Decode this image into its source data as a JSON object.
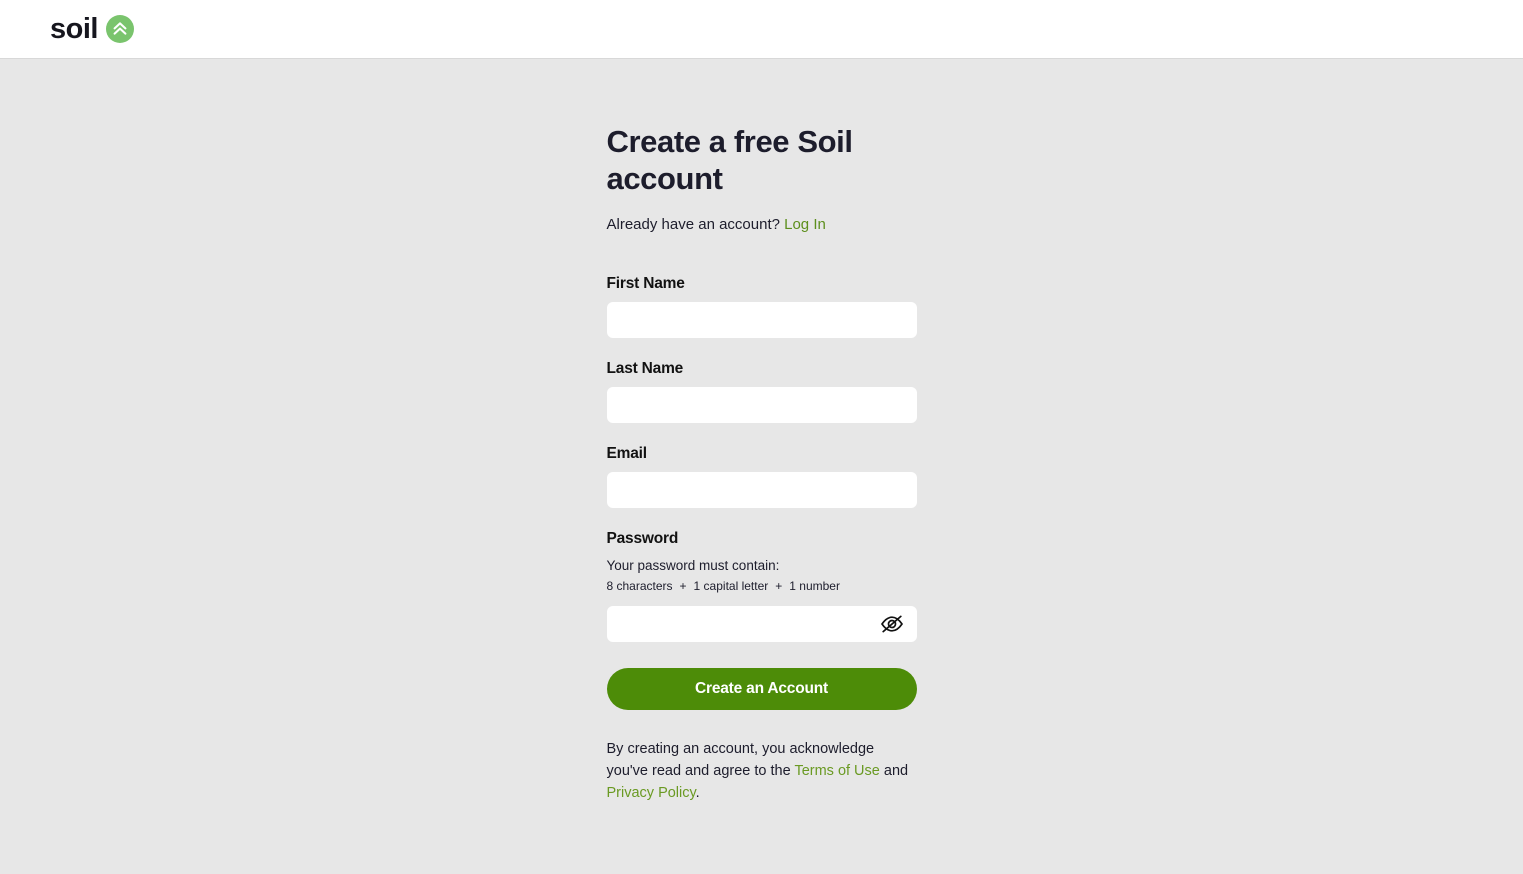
{
  "header": {
    "brand_name": "soil",
    "brand_icon": "double-chevron-up-icon"
  },
  "signup": {
    "title": "Create a free Soil account",
    "login_prompt_text": "Already have an account?",
    "login_link_label": "Log In",
    "fields": {
      "first_name": {
        "label": "First Name",
        "value": "",
        "placeholder": ""
      },
      "last_name": {
        "label": "Last Name",
        "value": "",
        "placeholder": ""
      },
      "email": {
        "label": "Email",
        "value": "",
        "placeholder": ""
      },
      "password": {
        "label": "Password",
        "value": "",
        "placeholder": "",
        "hint": "Your password must contain:",
        "rules": [
          "8 characters",
          "1 capital letter",
          "1 number"
        ],
        "rule_separator": "+",
        "toggle_icon": "eye-slash-icon"
      }
    },
    "submit_label": "Create an Account",
    "legal": {
      "lead_text": "By creating an account, you acknowledge you've read and agree to the",
      "terms_link_label": "Terms of Use",
      "conjunction": "and",
      "privacy_link_label": "Privacy Policy",
      "period": "."
    }
  },
  "colors": {
    "page_background": "#e7e7e7",
    "header_background": "#ffffff",
    "brand_mark_green": "#7ac46d",
    "link_green": "#5d8f1d",
    "legal_link_green": "#6a9a23",
    "button_green": "#4d8c08",
    "heading_navy": "#1d1d2c"
  }
}
